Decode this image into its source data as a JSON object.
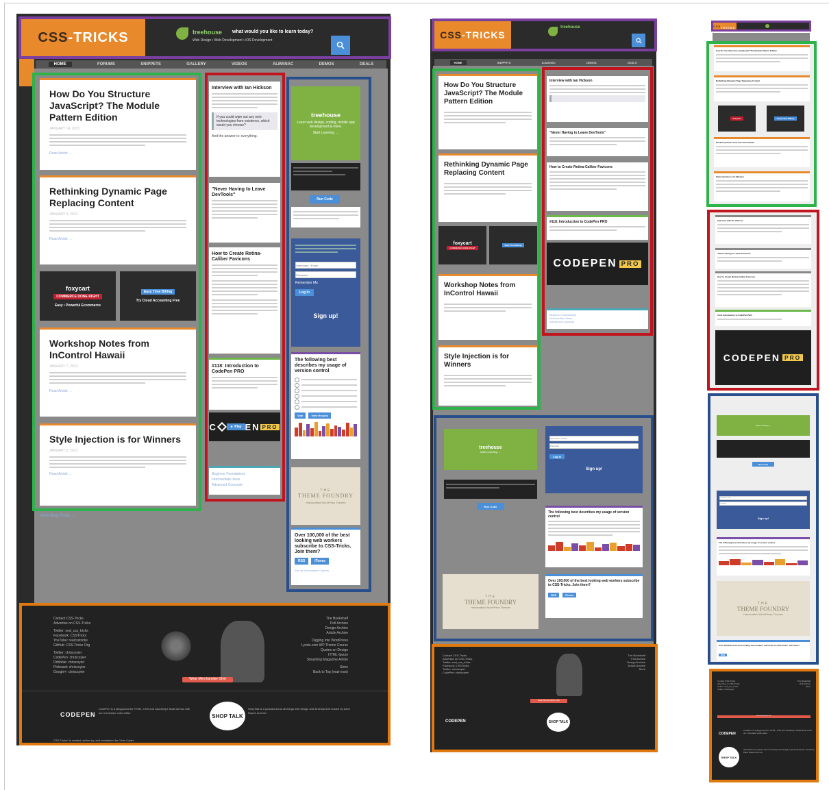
{
  "site": {
    "logo_prefix": "CSS",
    "logo_suffix": "-TRICKS",
    "treehouse_brand": "treehouse",
    "treehouse_tagline": "what would you like to learn today?",
    "treehouse_sub": "Web Design • Web Development • iOS Development",
    "search_icon": "search-icon"
  },
  "nav": [
    "HOME",
    "FORUMS",
    "SNIPPETS",
    "GALLERY",
    "VIDEOS",
    "ALMANAC",
    "DEMOS",
    "DEALS"
  ],
  "articles": [
    {
      "title": "How Do You Structure JavaScript? The Module Pattern Edition",
      "date": "JANUARY 14, 2013",
      "read": "Read Article →"
    },
    {
      "title": "Rethinking Dynamic Page Replacing Content",
      "date": "JANUARY 9, 2013",
      "read": "Read Article →"
    },
    {
      "title": "Workshop Notes from InControl Hawaii",
      "date": "JANUARY 7, 2013",
      "read": "Read Article →"
    },
    {
      "title": "Style Injection is for Winners",
      "date": "JANUARY 3, 2013",
      "read": "Read Article →"
    }
  ],
  "ads": [
    {
      "brand": "foxycart",
      "badge": "COMMERCE DONE RIGHT",
      "caption": "Easy • Powerful Ecommerce"
    },
    {
      "brand": "Try Cloud Accounting Free",
      "badge": "Easy Time Billing",
      "caption": "Try Cloud Accounting Free"
    }
  ],
  "more_posts": "More Blog Posts →",
  "middle": [
    {
      "title": "Interview with Ian Hickson",
      "quote": "If you could wipe out any web technologies from existence, which would you choose?",
      "end": "And the answer is: everything."
    },
    {
      "title": "\"Never Having to Leave DevTools\""
    },
    {
      "title": "How to Create Retina-Caliber Favicons"
    },
    {
      "title": "#118: Introduction to CodePen PRO"
    }
  ],
  "codepen": {
    "word_a": "C",
    "word_b": "D",
    "word_c": "EN",
    "play": "► Play",
    "pro": "PRO",
    "full": "CODEPEN"
  },
  "related": [
    "Beginner Foundations",
    "Intermediate Ideas",
    "Advanced Concepts"
  ],
  "right": {
    "treehouse_cta": "Start Learning →",
    "treehouse_text": "Learn web design, coding, mobile app development & more.",
    "run_code": "Run Code",
    "login_placeholder_user": "Username / Email",
    "login_placeholder_pass": "Password",
    "remember": "Remember Me",
    "login_btn": "Log In",
    "signup": "Sign up!",
    "poll_title": "The following best describes my usage of version control",
    "poll_vote": "Vote",
    "poll_results": "View Results",
    "theme_foundry_top": "THE",
    "theme_foundry": "THEME FOUNDRY",
    "theme_foundry_sub": "Handcrafted WordPress Themes",
    "subscribe_title": "Over 100,000 of the best looking web workers subscribe to CSS-Tricks. Join them?",
    "rss": "RSS",
    "itunes": "iTunes",
    "all_sub": "See all Subscription Options"
  },
  "footer": {
    "left": [
      "Contact CSS-Tricks",
      "Advertise on CSS-Tricks",
      "",
      "Twitter: real_css_tricks",
      "Facebook: CSSTricks",
      "YouTube: realcsstricks",
      "GitHub: CSS-Tricks Org",
      "",
      "Twitter: chriscoyier",
      "CodePen: chriscoyier",
      "Dribbble: chriscoyier",
      "Pinboard: chriscoyier",
      "Google+: chriscoyier"
    ],
    "right": [
      "The Bookshelf",
      "Poll Archive",
      "Design Archive",
      "Article Archive",
      "",
      "Digging Into WordPress",
      "Lynda.com WP Theme Course",
      "Quotes on Design",
      "HTML-Ipsum",
      "Smashing Magazine Article",
      "",
      "Store",
      "Back to Top (main nav)"
    ],
    "merch": "Wear Merchandise Shirt",
    "codepen_blurb": "CodePen is a playground for HTML, CSS and JavaScript. Build demos with our in-browser code editor.",
    "shoptalk": "SHOP TALK",
    "shoptalk_blurb": "ShopTalk is a podcast about all things web design and development hosted by Dave Rupert and me.",
    "copyright": "CSS-Tricks* is created, written by, and maintained by Chris Coyier."
  }
}
